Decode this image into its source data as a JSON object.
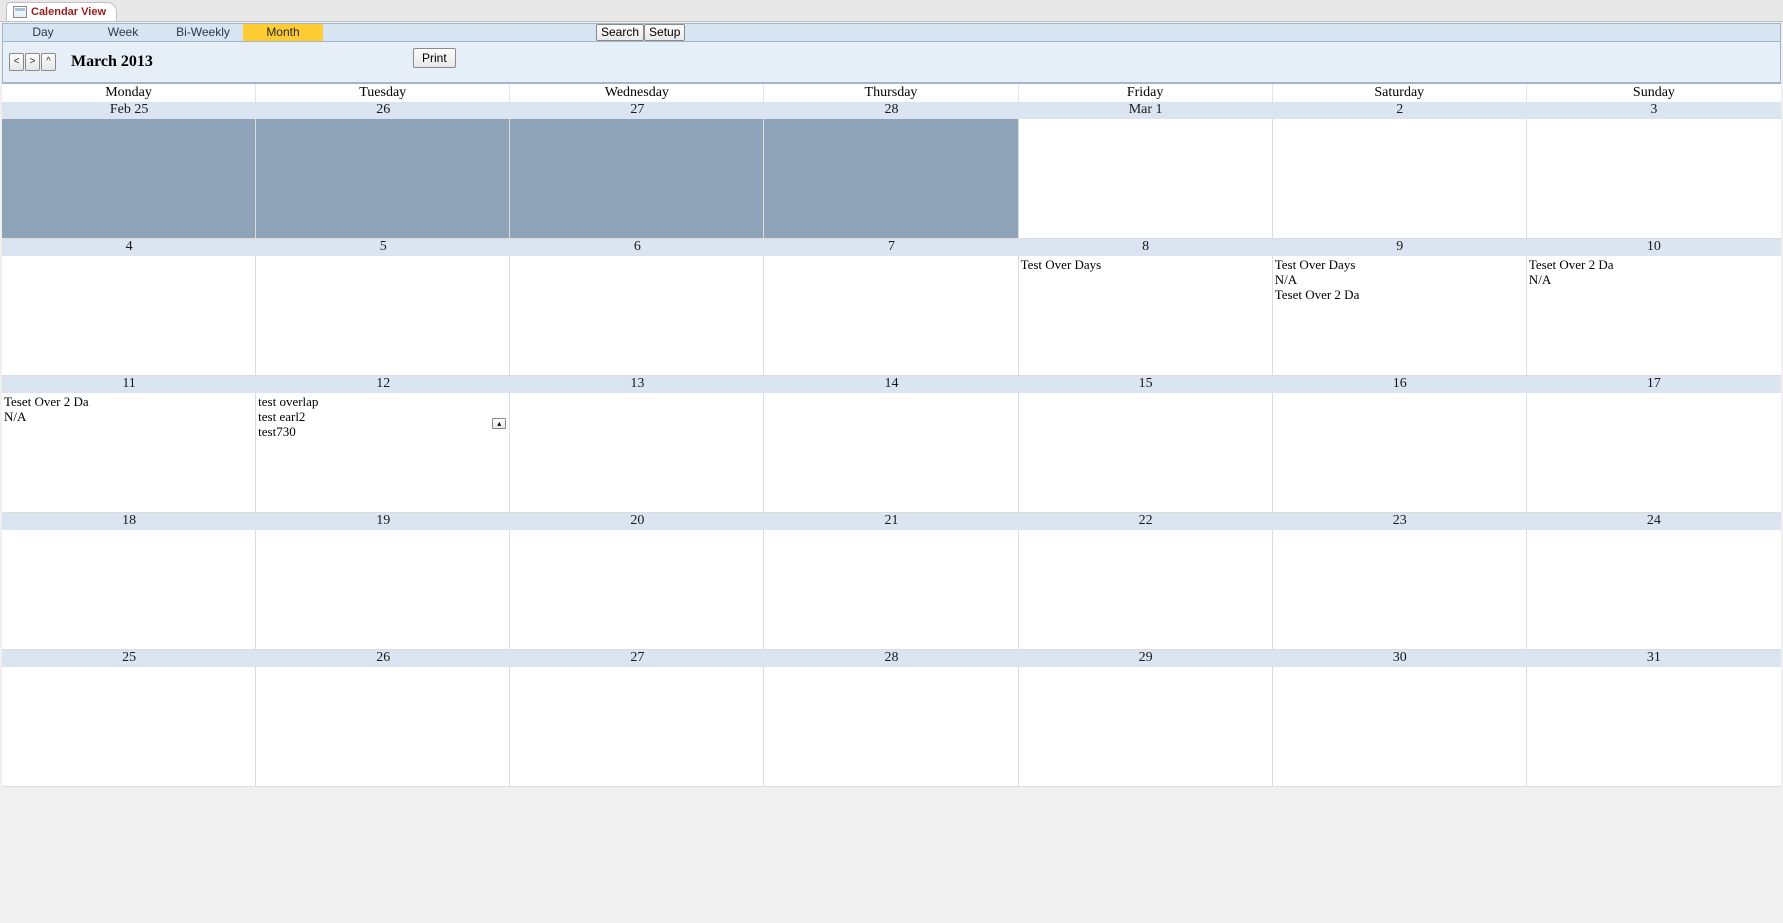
{
  "tab": {
    "title": "Calendar View"
  },
  "viewTabs": {
    "day": "Day",
    "week": "Week",
    "biweekly": "Bi-Weekly",
    "month": "Month",
    "active": "month"
  },
  "actions": {
    "search": "Search",
    "setup": "Setup",
    "print": "Print"
  },
  "nav": {
    "prev": "<",
    "next": ">",
    "up": "^",
    "monthLabel": "March 2013"
  },
  "daysOfWeek": [
    "Monday",
    "Tuesday",
    "Wednesday",
    "Thursday",
    "Friday",
    "Saturday",
    "Sunday"
  ],
  "weeks": [
    {
      "dates": [
        "Feb 25",
        "26",
        "27",
        "28",
        "Mar 1",
        "2",
        "3"
      ],
      "cells": [
        {
          "shaded": true,
          "events": []
        },
        {
          "shaded": true,
          "events": []
        },
        {
          "shaded": true,
          "events": []
        },
        {
          "shaded": true,
          "events": []
        },
        {
          "shaded": false,
          "events": []
        },
        {
          "shaded": false,
          "events": []
        },
        {
          "shaded": false,
          "events": []
        }
      ]
    },
    {
      "dates": [
        "4",
        "5",
        "6",
        "7",
        "8",
        "9",
        "10"
      ],
      "cells": [
        {
          "shaded": false,
          "events": []
        },
        {
          "shaded": false,
          "events": []
        },
        {
          "shaded": false,
          "events": []
        },
        {
          "shaded": false,
          "events": []
        },
        {
          "shaded": false,
          "events": [
            "Test Over Days"
          ]
        },
        {
          "shaded": false,
          "events": [
            "Test Over Days",
            "N/A",
            "Teset Over 2 Da"
          ]
        },
        {
          "shaded": false,
          "events": [
            "Teset Over 2 Da",
            "N/A"
          ]
        }
      ]
    },
    {
      "dates": [
        "11",
        "12",
        "13",
        "14",
        "15",
        "16",
        "17"
      ],
      "cells": [
        {
          "shaded": false,
          "events": [
            "Teset Over 2 Da",
            "N/A"
          ]
        },
        {
          "shaded": false,
          "events": [
            "test overlap",
            "test earl2",
            "test730"
          ],
          "more": true
        },
        {
          "shaded": false,
          "events": []
        },
        {
          "shaded": false,
          "events": []
        },
        {
          "shaded": false,
          "events": []
        },
        {
          "shaded": false,
          "events": []
        },
        {
          "shaded": false,
          "events": []
        }
      ]
    },
    {
      "dates": [
        "18",
        "19",
        "20",
        "21",
        "22",
        "23",
        "24"
      ],
      "cells": [
        {
          "shaded": false,
          "events": []
        },
        {
          "shaded": false,
          "events": []
        },
        {
          "shaded": false,
          "events": []
        },
        {
          "shaded": false,
          "events": []
        },
        {
          "shaded": false,
          "events": []
        },
        {
          "shaded": false,
          "events": []
        },
        {
          "shaded": false,
          "events": []
        }
      ]
    },
    {
      "dates": [
        "25",
        "26",
        "27",
        "28",
        "29",
        "30",
        "31"
      ],
      "cells": [
        {
          "shaded": false,
          "events": []
        },
        {
          "shaded": false,
          "events": []
        },
        {
          "shaded": false,
          "events": []
        },
        {
          "shaded": false,
          "events": []
        },
        {
          "shaded": false,
          "events": []
        },
        {
          "shaded": false,
          "events": []
        },
        {
          "shaded": false,
          "events": []
        }
      ]
    }
  ],
  "moreGlyph": "▴"
}
